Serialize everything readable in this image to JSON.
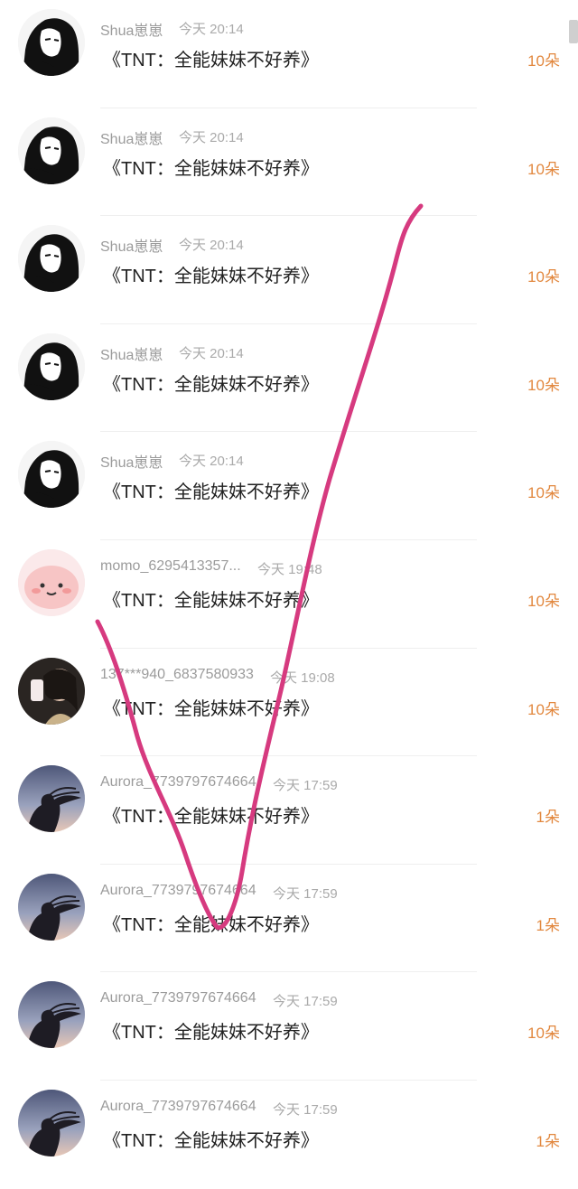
{
  "colors": {
    "accent": "#e2883f",
    "annotation": "#d63a7f"
  },
  "rows": [
    {
      "name": "Shua崽崽",
      "time": "今天 20:14",
      "title": "《TNT：全能妹妹不好养》",
      "count": "10朵",
      "avatar": "manga-girl"
    },
    {
      "name": "Shua崽崽",
      "time": "今天 20:14",
      "title": "《TNT：全能妹妹不好养》",
      "count": "10朵",
      "avatar": "manga-girl"
    },
    {
      "name": "Shua崽崽",
      "time": "今天 20:14",
      "title": "《TNT：全能妹妹不好养》",
      "count": "10朵",
      "avatar": "manga-girl"
    },
    {
      "name": "Shua崽崽",
      "time": "今天 20:14",
      "title": "《TNT：全能妹妹不好养》",
      "count": "10朵",
      "avatar": "manga-girl"
    },
    {
      "name": "Shua崽崽",
      "time": "今天 20:14",
      "title": "《TNT：全能妹妹不好养》",
      "count": "10朵",
      "avatar": "manga-girl"
    },
    {
      "name": "momo_6295413357...",
      "time": "今天 19:48",
      "title": "《TNT：全能妹妹不好养》",
      "count": "10朵",
      "avatar": "pink-blob"
    },
    {
      "name": "137***940_6837580933",
      "time": "今天 19:08",
      "title": "《TNT：全能妹妹不好养》",
      "count": "10朵",
      "avatar": "selfie-girl"
    },
    {
      "name": "Aurora_7739797674664",
      "time": "今天 17:59",
      "title": "《TNT：全能妹妹不好养》",
      "count": "1朵",
      "avatar": "silhouette-hair"
    },
    {
      "name": "Aurora_7739797674664",
      "time": "今天 17:59",
      "title": "《TNT：全能妹妹不好养》",
      "count": "1朵",
      "avatar": "silhouette-hair"
    },
    {
      "name": "Aurora_7739797674664",
      "time": "今天 17:59",
      "title": "《TNT：全能妹妹不好养》",
      "count": "10朵",
      "avatar": "silhouette-hair"
    },
    {
      "name": "Aurora_7739797674664",
      "time": "今天 17:59",
      "title": "《TNT：全能妹妹不好养》",
      "count": "1朵",
      "avatar": "silhouette-hair"
    }
  ]
}
